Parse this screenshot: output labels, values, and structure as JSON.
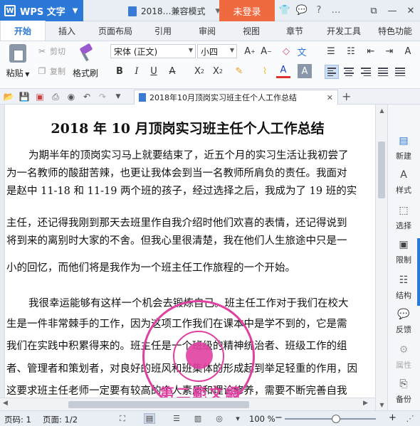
{
  "titlebar": {
    "app_label": "WPS 文字",
    "doc_title": "2018…兼容模式",
    "login": "未登录"
  },
  "menu_tabs": [
    "开始",
    "插入",
    "页面布局",
    "引用",
    "审阅",
    "视图",
    "章节",
    "开发工具",
    "特色功能"
  ],
  "ribbon": {
    "paste": "粘贴",
    "cut": "剪切",
    "copy": "复制",
    "format_painter": "格式刷",
    "font_name": "宋体 (正文)",
    "font_size": "小四"
  },
  "doc_tab": {
    "title": "2018年10月顶岗实习班主任个人工作总结"
  },
  "document": {
    "heading": "2018 年 10 月顶岗实习班主任个人工作总结",
    "lines": [
      "为期半年的顶岗实习马上就要结束了，近五个月的实习生活让我初尝了",
      "为一名教师的酸甜苦辣，也更让我体会到当一名教师所肩负的责任。我面对",
      "是赵中 11-18 和 11-19 两个班的孩子，经过选择之后，我成为了 19 班的实",
      "主任，还记得我刚到那天去班里作自我介绍时他们欢喜的表情，还记得说到",
      "将到来的离别时大家的不舍。但我心里很清楚，我在他们人生旅途中只是一",
      "小的回忆，而他们将是我作为一个班主任工作旅程的一个开始。",
      "",
      "我很幸运能够有这样一个机会去锻炼自己。班主任工作对于我们在校大",
      "生是一件非常棘手的工作，因为这项工作我们在课本中是学不到的，它是需",
      "我们在实践中积累得来的。班主任是一个班级的精神统治者、班级工作的组",
      "者、管理者和策划者，对良好的班风和班集体的形成起到举足轻重的作用，因",
      "这要求班主任老师一定要有较高的个人素质和理论修养，需要不断完善自我"
    ],
    "stamp_name": "第二範文網"
  },
  "sidebar": [
    {
      "label": "新建",
      "icon": "new-doc-icon"
    },
    {
      "label": "样式",
      "icon": "style-icon"
    },
    {
      "label": "选择",
      "icon": "select-icon"
    },
    {
      "label": "限制",
      "icon": "restrict-icon"
    },
    {
      "label": "结构",
      "icon": "structure-icon"
    },
    {
      "label": "反馈",
      "icon": "feedback-icon"
    },
    {
      "label": "属性",
      "icon": "properties-icon"
    },
    {
      "label": "备份",
      "icon": "backup-icon"
    }
  ],
  "status": {
    "page_code": "页码: 1",
    "page": "页面: 1/2",
    "zoom": "100 %",
    "minus": "−",
    "plus": "+"
  },
  "colors": {
    "accent": "#2b78d6",
    "login": "#f06a3f",
    "stamp": "#e040a0"
  }
}
